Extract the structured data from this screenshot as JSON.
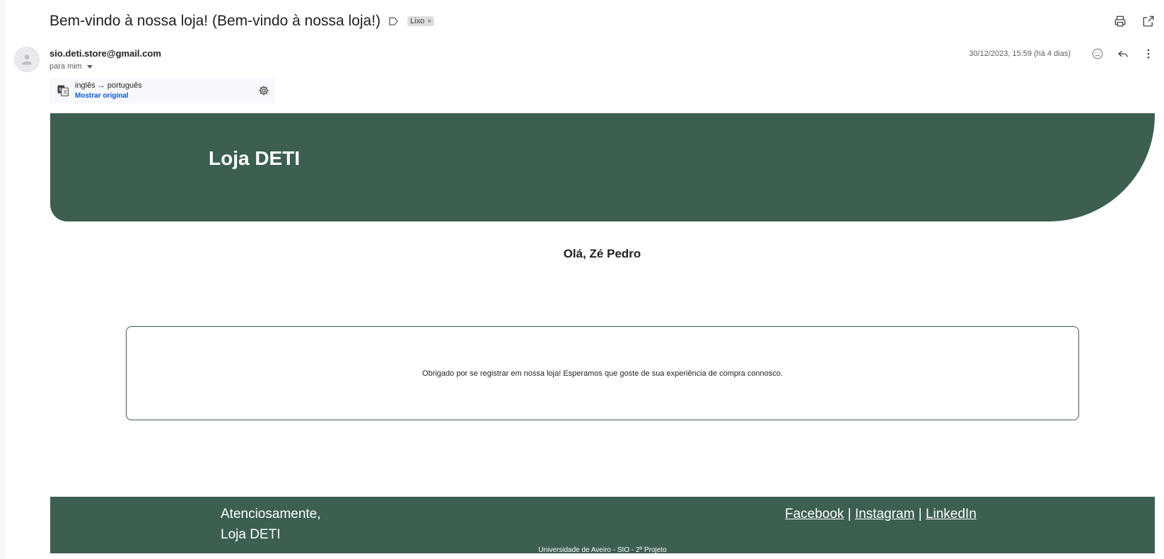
{
  "email": {
    "subject": "Bem-vindo à nossa loja! (Bem-vindo à nossa loja!)",
    "label": "Lixo",
    "label_close": "×",
    "sender": "sio.deti.store@gmail.com",
    "recipient": "para mim",
    "date": "30/12/2023, 15:59 (há 4 dias)"
  },
  "translation": {
    "languages": "inglês → português",
    "show_original": "Mostrar original"
  },
  "body": {
    "store_title": "Loja DETI",
    "greeting": "Olá, Zé Pedro",
    "message": "Obrigado por se registrar em nossa loja! Esperamos que goste de sua experiência de compra connosco.",
    "closing_line1": "Atenciosamente,",
    "closing_line2": "Loja DETI",
    "social": {
      "facebook": "Facebook",
      "instagram": "Instagram",
      "linkedin": "LinkedIn",
      "separator": "|"
    },
    "footer_note": "Universidade de Aveiro - SIO - 2º Projeto"
  },
  "icons": {
    "print": "print-icon",
    "open_new_window": "open-in-new-icon",
    "emoji": "emoji-icon",
    "reply": "reply-icon",
    "more": "more-vert-icon",
    "translate": "translate-icon",
    "settings": "gear-icon",
    "label_arrow": "label-arrow-icon"
  },
  "colors": {
    "brand_green": "#3c5f50",
    "link_blue": "#0b57d0"
  }
}
